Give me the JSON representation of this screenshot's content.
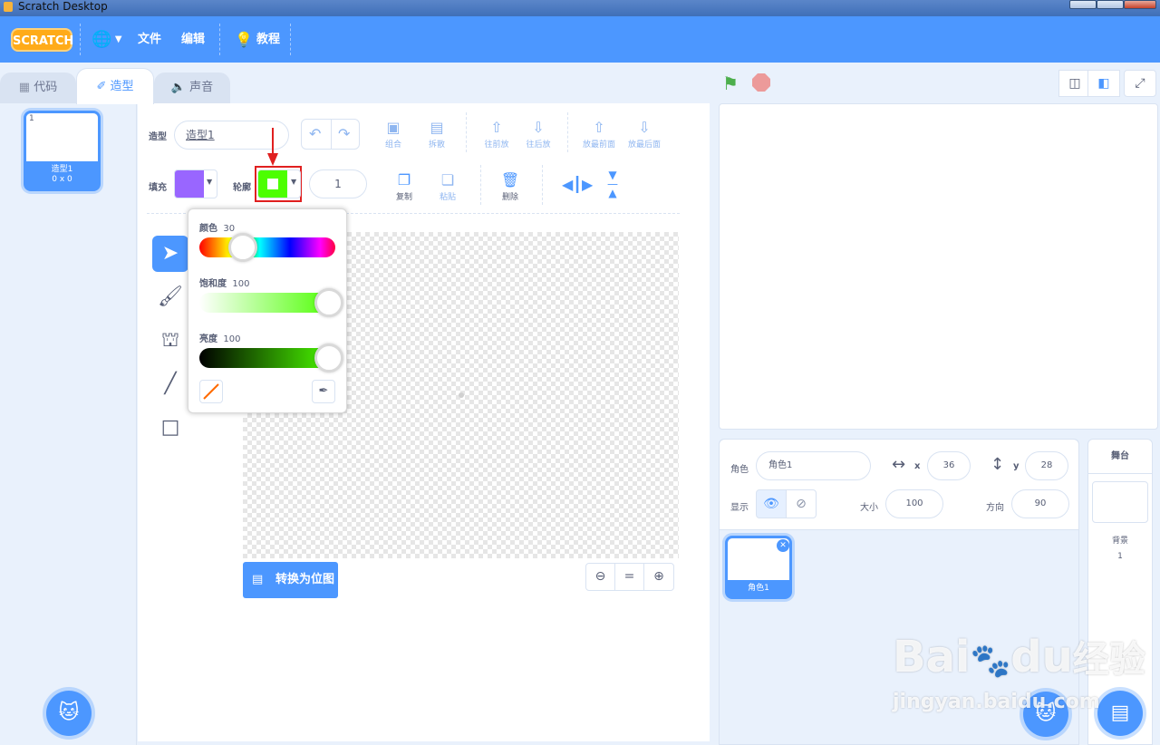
{
  "window": {
    "title": "Scratch Desktop"
  },
  "menubar": {
    "logo": "SCRATCH",
    "file": "文件",
    "edit": "编辑",
    "tutorials": "教程"
  },
  "tabs": [
    {
      "label": "代码",
      "icon": "code-icon"
    },
    {
      "label": "造型",
      "icon": "brush-icon"
    },
    {
      "label": "声音",
      "icon": "speaker-icon"
    }
  ],
  "costume_list": {
    "items": [
      {
        "index": "1",
        "name": "造型1",
        "size": "0 x 0"
      }
    ]
  },
  "editor": {
    "costume_label": "造型",
    "costume_name": "造型1",
    "fill_label": "填充",
    "fill_color": "#9966ff",
    "outline_label": "轮廓",
    "outline_color": "#4cff00",
    "outline_width": "1",
    "group_label": "组合",
    "ungroup_label": "拆散",
    "forward_label": "往前放",
    "backward_label": "往后放",
    "front_label": "放最前面",
    "back_label": "放最后面",
    "copy_label": "复制",
    "paste_label": "粘贴",
    "delete_label": "删除",
    "convert_button": "转换为位图"
  },
  "color_popup": {
    "hue_label": "颜色",
    "hue_value": "30",
    "hue_percent": 30,
    "saturation_label": "饱和度",
    "saturation_value": "100",
    "saturation_percent": 100,
    "brightness_label": "亮度",
    "brightness_value": "100",
    "brightness_percent": 100
  },
  "sprite_info": {
    "sprite_label": "角色",
    "sprite_name": "角色1",
    "x_label": "x",
    "x_value": "36",
    "y_label": "y",
    "y_value": "28",
    "show_label": "显示",
    "size_label": "大小",
    "size_value": "100",
    "direction_label": "方向",
    "direction_value": "90"
  },
  "sprites": [
    {
      "name": "角色1"
    }
  ],
  "stage_panel": {
    "title": "舞台",
    "backdrop_label": "背景",
    "backdrop_count": "1"
  },
  "watermark": {
    "brand": "Bai",
    "brand2": "du",
    "cn": "经验",
    "url": "jingyan.baidu.com"
  },
  "colors": {
    "accent": "#4c97ff",
    "highlight": "#e02020"
  }
}
